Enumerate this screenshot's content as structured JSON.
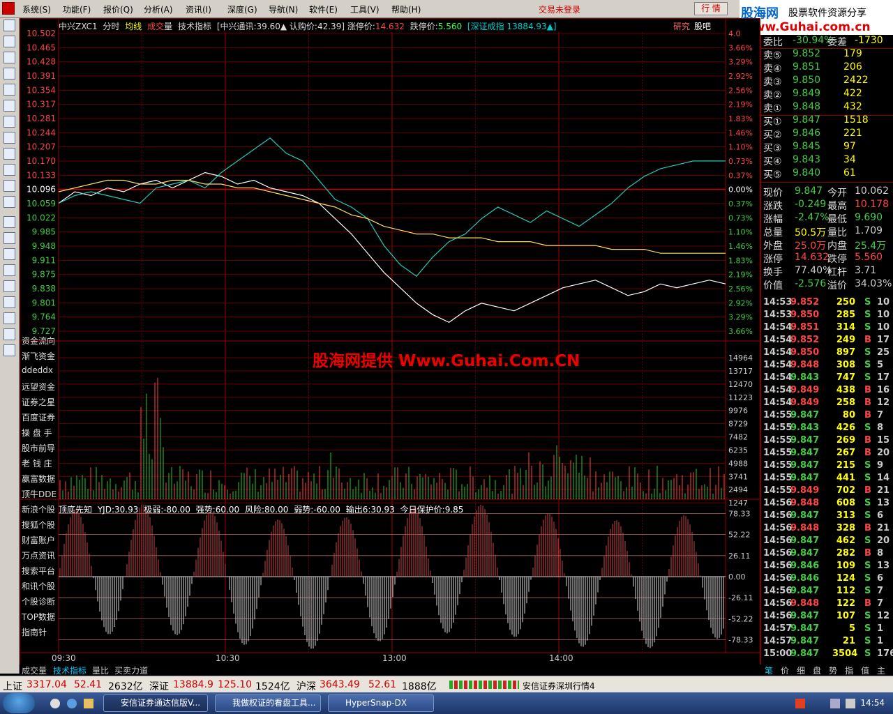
{
  "menu": {
    "items": [
      "系统(S)",
      "功能(F)",
      "报价(Q)",
      "分析(A)",
      "资讯(I)",
      "深度(G)",
      "导航(N)",
      "软件(E)",
      "工具(V)",
      "帮助(H)"
    ],
    "login": "交易未登录",
    "hangqing": "行 情"
  },
  "brand": {
    "name": "股海网",
    "slogan": "股票软件资源分享",
    "url": "Www.Guhai.com.cn"
  },
  "header": {
    "name": "中兴ZXC1",
    "mode": "分时",
    "avg": "均线",
    "vol_a": "成交",
    "vol_b": "量",
    "tech": "技术指标",
    "info": "[中兴通讯:39.60▲ 认购价:42.39] 涨停价:",
    "limit_up": "14.632",
    "limit_down_lbl": "跌停价:",
    "limit_down": "5.560",
    "index": "[深证成指 13884.93▲]",
    "research": "研究",
    "guba": "股吧"
  },
  "watermark": "股海网提供 Www.Guhai.Com.CN",
  "indicator": {
    "name": "顶底先知",
    "yjd": "YJD:30.93",
    "jr": "极弱:-80.00",
    "qs": "强势:60.00",
    "fx": "风险:80.00",
    "rs": "弱势:-60.00",
    "sc": "输出6:30.93",
    "bh": "今日保护价:9.85"
  },
  "sidebar_links": [
    "资金流向",
    "渐飞资金",
    "ddeddx",
    "远望资金",
    "证券之星",
    "百度证券",
    "操 盘 手",
    "股市前导",
    "老 钱 庄",
    "赢富数据",
    "顶牛DDE",
    "新浪个股",
    "搜狐个股",
    "财富账户",
    "万点资讯",
    "搜索平台",
    "和讯个股",
    "个股诊断",
    "TOP数据",
    "指南针"
  ],
  "bottom_tabs": [
    "成交量",
    "技术指标",
    "量比",
    "买卖力道"
  ],
  "chart_data": [
    {
      "type": "line",
      "title": "中兴ZXC1 分时",
      "x": [
        "09:30",
        "10:30",
        "13:00",
        "14:00"
      ],
      "ylim": [
        9.727,
        10.502
      ],
      "yticks": [
        "10.502",
        "10.465",
        "10.428",
        "10.391",
        "10.354",
        "10.317",
        "10.281",
        "10.244",
        "10.207",
        "10.170",
        "10.133",
        "10.096",
        "10.059",
        "10.022",
        "9.985",
        "9.948",
        "9.911",
        "9.875",
        "9.838",
        "9.801",
        "9.764",
        "9.727"
      ],
      "pct_ticks": [
        "4.0",
        "3.66%",
        "3.29%",
        "2.92%",
        "2.56%",
        "2.19%",
        "1.83%",
        "1.46%",
        "1.10%",
        "0.73%",
        "0.37%",
        "0.00%",
        "0.37%",
        "0.73%",
        "1.10%",
        "1.46%",
        "1.83%",
        "2.19%",
        "2.56%",
        "2.92%",
        "3.29%",
        "3.66%"
      ],
      "prev_close": 10.096,
      "series": [
        {
          "values": [
            10.06,
            10.09,
            10.08,
            10.1,
            10.09,
            10.11,
            10.12,
            10.1,
            10.12,
            10.14,
            10.13,
            10.11,
            10.12,
            10.1,
            10.09,
            10.08,
            10.06,
            10.02,
            9.98,
            9.93,
            9.88,
            9.84,
            9.8,
            9.77,
            9.75,
            9.78,
            9.8,
            9.79,
            9.78,
            9.8,
            9.82,
            9.84,
            9.85,
            9.86,
            9.84,
            9.82,
            9.83,
            9.85,
            9.84,
            9.85,
            9.86,
            9.85
          ]
        },
        {
          "values": [
            10.06,
            10.08,
            10.09,
            10.08,
            10.07,
            10.06,
            10.1,
            10.11,
            10.12,
            10.1,
            10.14,
            10.17,
            10.2,
            10.23,
            10.19,
            10.17,
            10.12,
            10.07,
            10.05,
            10.02,
            9.95,
            9.9,
            9.87,
            9.92,
            9.96,
            9.98,
            10.02,
            10.05,
            10.03,
            10.01,
            10.04,
            10.02,
            10.0,
            10.03,
            10.06,
            10.1,
            10.13,
            10.15,
            10.16,
            10.17,
            10.17,
            10.17
          ]
        },
        {
          "values": [
            10.09,
            10.1,
            10.11,
            10.12,
            10.12,
            10.11,
            10.11,
            10.12,
            10.12,
            10.11,
            10.11,
            10.1,
            10.1,
            10.09,
            10.08,
            10.07,
            10.06,
            10.05,
            10.03,
            10.02,
            10.0,
            9.99,
            9.98,
            9.98,
            9.97,
            9.97,
            9.97,
            9.96,
            9.96,
            9.96,
            9.95,
            9.95,
            9.95,
            9.95,
            9.94,
            9.94,
            9.94,
            9.93,
            9.93,
            9.93,
            9.93,
            9.93
          ]
        }
      ]
    },
    {
      "type": "bar",
      "title": "成交量",
      "yticks": [
        "14964",
        "13717",
        "12470",
        "11223",
        "9976",
        "8729",
        "7482",
        "6235",
        "4988",
        "3741",
        "2494",
        "1247"
      ],
      "ylim": [
        0,
        14964
      ]
    },
    {
      "type": "bar",
      "title": "顶底先知",
      "yticks": [
        "78.33",
        "52.22",
        "26.11",
        "0.00",
        "-26.11",
        "-52.22",
        "-78.33"
      ],
      "ylim": [
        -90,
        90
      ]
    }
  ],
  "quote": {
    "rows": [
      {
        "l": "委比",
        "v": "-30.94%",
        "l2": "委差",
        "v2": "-1730"
      },
      {
        "l": "卖⑤",
        "v": "9.852",
        "v2": "179"
      },
      {
        "l": "卖④",
        "v": "9.851",
        "v2": "206"
      },
      {
        "l": "卖③",
        "v": "9.850",
        "v2": "2422"
      },
      {
        "l": "卖②",
        "v": "9.849",
        "v2": "422"
      },
      {
        "l": "卖①",
        "v": "9.848",
        "v2": "432"
      },
      {
        "l": "买①",
        "v": "9.847",
        "v2": "1518"
      },
      {
        "l": "买②",
        "v": "9.846",
        "v2": "221"
      },
      {
        "l": "买③",
        "v": "9.845",
        "v2": "97"
      },
      {
        "l": "买④",
        "v": "9.843",
        "v2": "34"
      },
      {
        "l": "买⑤",
        "v": "9.840",
        "v2": "61"
      },
      {
        "l": "现价",
        "v": "9.847",
        "l2": "今开",
        "v2": "10.062"
      },
      {
        "l": "涨跌",
        "v": "-0.249",
        "l2": "最高",
        "v2": "10.178"
      },
      {
        "l": "涨幅",
        "v": "-2.47%",
        "l2": "最低",
        "v2": "9.690"
      },
      {
        "l": "总量",
        "v": "50.5万",
        "l2": "量比",
        "v2": "1.709"
      },
      {
        "l": "外盘",
        "v": "25.0万",
        "l2": "内盘",
        "v2": "25.4万"
      },
      {
        "l": "涨停",
        "v": "14.632",
        "l2": "跌停",
        "v2": "5.560"
      },
      {
        "l": "换手",
        "v": "77.40%",
        "l2": "杠杆",
        "v2": "3.71"
      },
      {
        "l": "价值",
        "v": "-2.576",
        "l2": "溢价",
        "v2": "34.03%"
      }
    ],
    "ticks": [
      [
        "14:53",
        "9.852",
        "250",
        "S",
        "10"
      ],
      [
        "14:53",
        "9.850",
        "285",
        "S",
        "10"
      ],
      [
        "14:54",
        "9.851",
        "314",
        "S",
        "10"
      ],
      [
        "14:54",
        "9.852",
        "249",
        "B",
        "17"
      ],
      [
        "14:54",
        "9.850",
        "897",
        "S",
        "25"
      ],
      [
        "14:54",
        "9.848",
        "308",
        "S",
        "5"
      ],
      [
        "14:54",
        "9.843",
        "747",
        "S",
        "17"
      ],
      [
        "14:54",
        "9.849",
        "438",
        "B",
        "16"
      ],
      [
        "14:54",
        "9.849",
        "258",
        "B",
        "12"
      ],
      [
        "14:55",
        "9.847",
        "80",
        "B",
        "7"
      ],
      [
        "14:55",
        "9.843",
        "426",
        "S",
        "8"
      ],
      [
        "14:55",
        "9.847",
        "269",
        "B",
        "15"
      ],
      [
        "14:55",
        "9.847",
        "267",
        "B",
        "20"
      ],
      [
        "14:55",
        "9.847",
        "215",
        "S",
        "9"
      ],
      [
        "14:55",
        "9.847",
        "441",
        "S",
        "14"
      ],
      [
        "14:55",
        "9.849",
        "702",
        "B",
        "21"
      ],
      [
        "14:56",
        "9.848",
        "608",
        "S",
        "13"
      ],
      [
        "14:56",
        "9.847",
        "313",
        "S",
        "6"
      ],
      [
        "14:56",
        "9.848",
        "328",
        "B",
        "21"
      ],
      [
        "14:56",
        "9.847",
        "462",
        "S",
        "20"
      ],
      [
        "14:56",
        "9.847",
        "282",
        "B",
        "8"
      ],
      [
        "14:56",
        "9.846",
        "109",
        "S",
        "13"
      ],
      [
        "14:56",
        "9.846",
        "124",
        "S",
        "6"
      ],
      [
        "14:56",
        "9.847",
        "112",
        "S",
        "7"
      ],
      [
        "14:56",
        "9.848",
        "122",
        "B",
        "7"
      ],
      [
        "14:56",
        "9.847",
        "107",
        "S",
        "12"
      ],
      [
        "14:57",
        "9.847",
        "5",
        "S",
        "1"
      ],
      [
        "14:57",
        "9.847",
        "21",
        "S",
        "1"
      ],
      [
        "15:00",
        "9.847",
        "3504",
        "S",
        "176"
      ]
    ],
    "tabs": [
      "笔",
      "价",
      "细",
      "盘",
      "势",
      "指",
      "值",
      "主"
    ]
  },
  "indexbar": {
    "sh_lbl": "上证",
    "sh": "3317.04",
    "sh_chg": "52.41",
    "sh_amt": "2632亿",
    "sz_lbl": "深证",
    "sz": "13884.9",
    "sz_chg": "125.10",
    "sz_amt": "1524亿",
    "hs_lbl": "沪深",
    "hs": "3643.49",
    "hs_chg": "52.61",
    "hs_amt": "1888亿",
    "feed": "安信证券深圳行情4"
  },
  "taskbar": {
    "tasks": [
      "安信证券通达信版V...",
      "我做权证的看盘工具...",
      "HyperSnap-DX"
    ],
    "time": "14:54"
  }
}
